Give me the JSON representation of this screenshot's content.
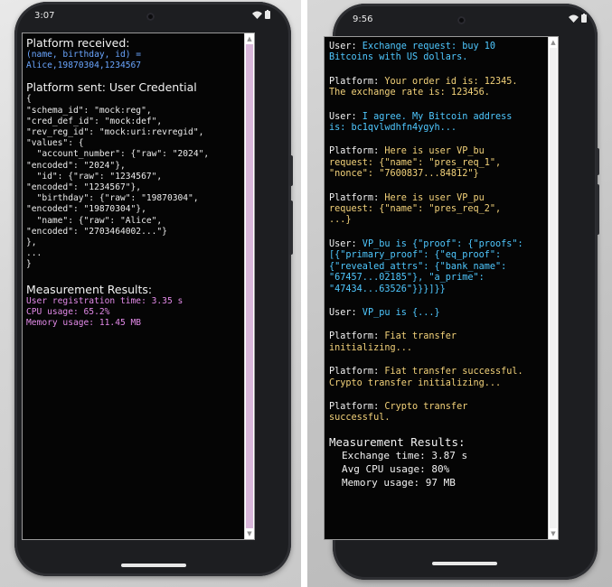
{
  "left_phone": {
    "status_time": "3:07",
    "received_title": "Platform received:",
    "received_lines": [
      "(name, birthday, id) =",
      "Alice,19870304,1234567"
    ],
    "sent_title": "Platform sent: User Credential",
    "credential_lines": [
      "{",
      "\"schema_id\": \"mock:reg\",",
      "\"cred_def_id\": \"mock:def\",",
      "\"rev_reg_id\": \"mock:uri:revregid\",",
      "\"values\": {",
      "  \"account_number\": {\"raw\": \"2024\",",
      "\"encoded\": \"2024\"},",
      "  \"id\": {\"raw\": \"1234567\",",
      "\"encoded\": \"1234567\"},",
      "  \"birthday\": {\"raw\": \"19870304\",",
      "\"encoded\": \"19870304\"},",
      "  \"name\": {\"raw\": \"Alice\",",
      "\"encoded\": \"2703464002...\"}",
      "},",
      "...",
      "}"
    ],
    "results_title": "Measurement Results:",
    "results_lines": [
      "User registration time: 3.35 s",
      "CPU usage: 65.2%",
      "Memory usage: 11.45 MB"
    ]
  },
  "right_phone": {
    "status_time": "9:56",
    "messages": [
      {
        "role": "user",
        "lines": [
          "User: Exchange request: buy 10",
          "Bitcoins with US dollars."
        ]
      },
      {
        "role": "platform",
        "lines": [
          "Platform: Your order id is: 12345.",
          "The exchange rate is: 123456."
        ]
      },
      {
        "role": "user",
        "lines": [
          "User: I agree. My Bitcoin address",
          "is: bc1qvlwdhfn4ygyh..."
        ]
      },
      {
        "role": "platform",
        "lines": [
          "Platform: Here is user VP_bu",
          "request: {\"name\": \"pres_req_1\",",
          "\"nonce\": \"7600837...84812\"}"
        ]
      },
      {
        "role": "platform",
        "lines": [
          "Platform: Here is user VP_pu",
          "request: {\"name\": \"pres_req_2\",",
          "...}"
        ]
      },
      {
        "role": "user",
        "lines": [
          "User: VP_bu is {\"proof\": {\"proofs\":",
          "[{\"primary_proof\": {\"eq_proof\":",
          "{\"revealed_attrs\": {\"bank_name\":",
          "\"67457...02185\"}, \"a_prime\":",
          "\"47434...63526\"}}}]}}"
        ]
      },
      {
        "role": "user",
        "lines": [
          "User: VP_pu is {...}"
        ]
      },
      {
        "role": "platform",
        "lines": [
          "Platform: Fiat transfer",
          "initializing..."
        ]
      },
      {
        "role": "platform",
        "lines": [
          "Platform: Fiat transfer successful.",
          "Crypto transfer initializing..."
        ]
      },
      {
        "role": "platform",
        "lines": [
          "Platform: Crypto transfer",
          "successful."
        ]
      }
    ],
    "results_title": "Measurement Results:",
    "results_lines": [
      "Exchange time: 3.87 s",
      "Avg CPU usage: 80%",
      "Memory usage: 97 MB"
    ]
  },
  "colors": {
    "user_label": "#4fc8ff",
    "platform_label": "#f3d27a",
    "left_blue": "#6aa6ff",
    "left_pink": "#e28ae8"
  },
  "icons": [
    "wifi-icon",
    "battery-icon"
  ]
}
